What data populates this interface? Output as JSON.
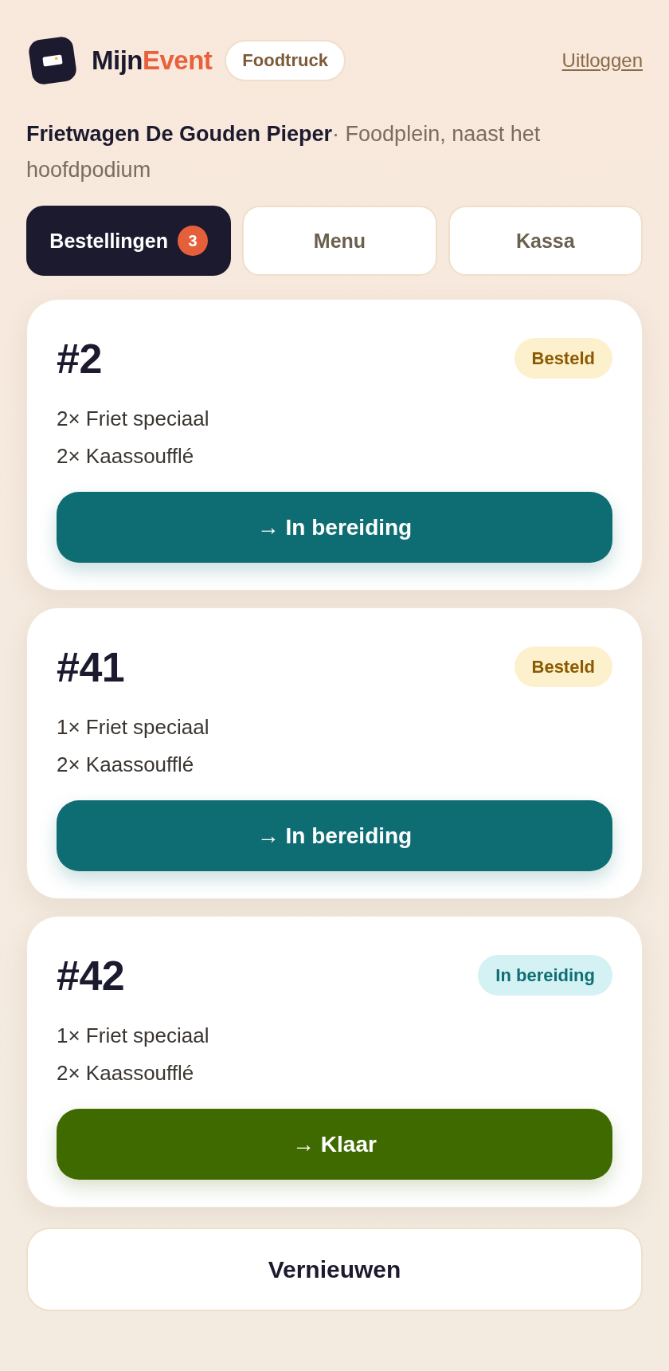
{
  "header": {
    "brand": [
      "Mijn",
      "Event"
    ],
    "role_badge": "Foodtruck",
    "logout": "Uitloggen"
  },
  "location": "**Frietwagen De Gouden Pieper**· Foodplein, naast het hoofdpodium",
  "tabs": [
    {
      "label": "Bestellingen",
      "badge": "3",
      "selected": true
    },
    {
      "label": "Menu",
      "selected": false
    },
    {
      "label": "Kassa",
      "selected": false
    }
  ],
  "orders": [
    {
      "number": "#2",
      "status": {
        "kind": "ordered",
        "label": "Besteld"
      },
      "items": [
        "2× Friet speciaal",
        "2× Kaassoufflé"
      ],
      "action": {
        "kind": "start",
        "label": "→ In bereiding"
      }
    },
    {
      "number": "#41",
      "status": {
        "kind": "ordered",
        "label": "Besteld"
      },
      "items": [
        "1× Friet speciaal",
        "2× Kaassoufflé"
      ],
      "action": {
        "kind": "start",
        "label": "→ In bereiding"
      }
    },
    {
      "number": "#42",
      "status": {
        "kind": "preparing",
        "label": "In bereiding"
      },
      "items": [
        "1× Friet speciaal",
        "2× Kaassoufflé"
      ],
      "action": {
        "kind": "finish",
        "label": "→ Klaar"
      }
    }
  ],
  "refresh_button": "Vernieuwen"
}
